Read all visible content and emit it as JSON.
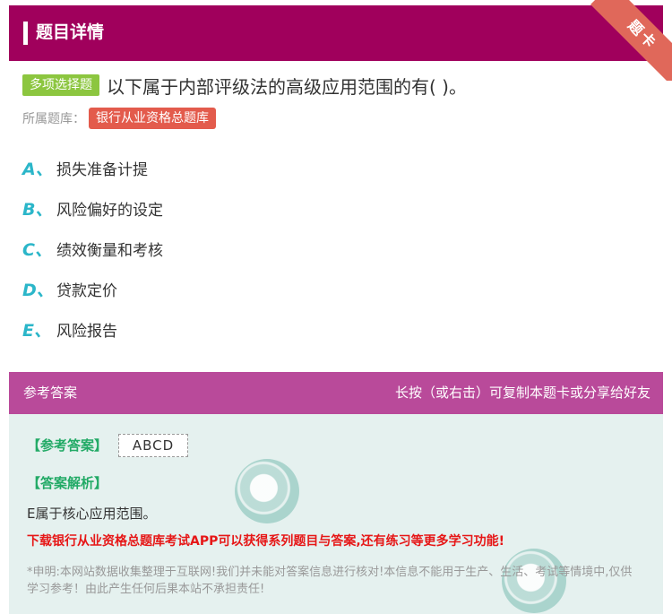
{
  "header": {
    "title": "题目详情",
    "corner_tag": "题卡"
  },
  "question": {
    "type_badge": "多项选择题",
    "text": "以下属于内部评级法的高级应用范围的有( )。",
    "bank_label": "所属题库：",
    "bank_name": "银行从业资格总题库"
  },
  "options": [
    {
      "letter": "A、",
      "text": "损失准备计提"
    },
    {
      "letter": "B、",
      "text": "风险偏好的设定"
    },
    {
      "letter": "C、",
      "text": "绩效衡量和考核"
    },
    {
      "letter": "D、",
      "text": "贷款定价"
    },
    {
      "letter": "E、",
      "text": "风险报告"
    }
  ],
  "answer_section": {
    "title": "参考答案",
    "hint": "长按（或右击）可复制本题卡或分享给好友",
    "answer_label": "【参考答案】",
    "answer_value": "ABCD",
    "analysis_label": "【答案解析】",
    "analysis_text": "E属于核心应用范围。",
    "promo": "下载银行从业资格总题库考试APP可以获得系列题目与答案,还有练习等更多学习功能!",
    "disclaimer": "*申明:本网站数据收集整理于互联网!我们并未能对答案信息进行核对!本信息不能用于生产、生活、考试等情境中,仅供学习参考！由此产生任何后果本站不承担责任!"
  },
  "colors": {
    "header_bg": "#a0005c",
    "answer_header_bg": "#b94a9a",
    "badge_green": "#8cc63f",
    "tag_red": "#e35b4c",
    "option_letter": "#2bb6c9",
    "answer_green": "#22aa66",
    "promo_red": "#e61717"
  }
}
